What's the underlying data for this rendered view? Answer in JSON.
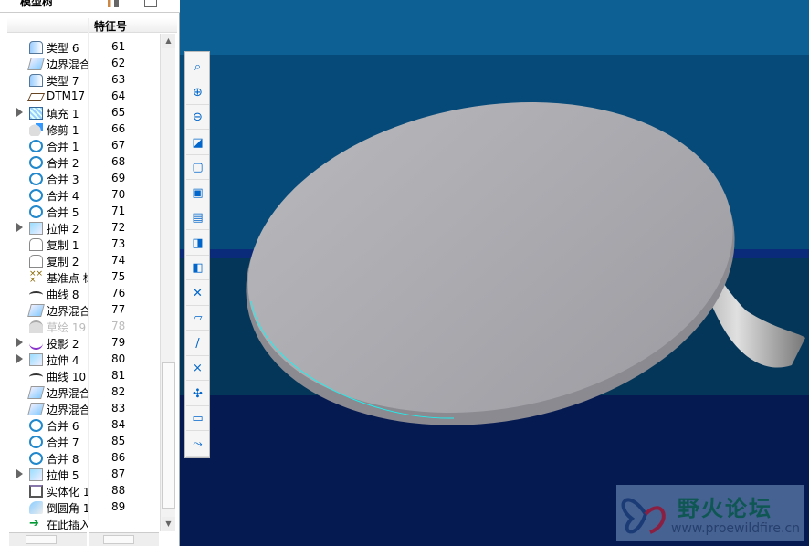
{
  "panel": {
    "title": "模型树",
    "column_header": "特征号"
  },
  "tree": [
    {
      "name": "类型 6",
      "id": "61",
      "icon": "surface-icon"
    },
    {
      "name": "边界混合",
      "id": "62",
      "icon": "boundary-blend-icon"
    },
    {
      "name": "类型 7",
      "id": "63",
      "icon": "surface-icon"
    },
    {
      "name": "DTM17",
      "id": "64",
      "icon": "datum-plane-icon"
    },
    {
      "name": "填充 1",
      "id": "65",
      "icon": "fill-icon",
      "expand": true
    },
    {
      "name": "修剪 1",
      "id": "66",
      "icon": "trim-icon"
    },
    {
      "name": "合并 1",
      "id": "67",
      "icon": "merge-icon"
    },
    {
      "name": "合并 2",
      "id": "68",
      "icon": "merge-icon"
    },
    {
      "name": "合并 3",
      "id": "69",
      "icon": "merge-icon"
    },
    {
      "name": "合并 4",
      "id": "70",
      "icon": "merge-icon"
    },
    {
      "name": "合并 5",
      "id": "71",
      "icon": "merge-icon"
    },
    {
      "name": "拉伸 2",
      "id": "72",
      "icon": "extrude-icon",
      "expand": true
    },
    {
      "name": "复制 1",
      "id": "73",
      "icon": "copy-icon"
    },
    {
      "name": "复制 2",
      "id": "74",
      "icon": "copy-icon"
    },
    {
      "name": "基准点 标",
      "id": "75",
      "icon": "datum-point-icon"
    },
    {
      "name": "曲线 8",
      "id": "76",
      "icon": "curve-icon"
    },
    {
      "name": "边界混合",
      "id": "77",
      "icon": "boundary-blend-icon"
    },
    {
      "name": "草绘 19",
      "id": "78",
      "icon": "sketch-icon",
      "dim": true
    },
    {
      "name": "投影 2",
      "id": "79",
      "icon": "project-icon",
      "expand": true
    },
    {
      "name": "拉伸 4",
      "id": "80",
      "icon": "extrude-icon",
      "expand": true
    },
    {
      "name": "曲线 10",
      "id": "81",
      "icon": "curve-icon"
    },
    {
      "name": "边界混合",
      "id": "82",
      "icon": "boundary-blend-icon"
    },
    {
      "name": "边界混合",
      "id": "83",
      "icon": "boundary-blend-icon"
    },
    {
      "name": "合并 6",
      "id": "84",
      "icon": "merge-icon"
    },
    {
      "name": "合并 7",
      "id": "85",
      "icon": "merge-icon"
    },
    {
      "name": "合并 8",
      "id": "86",
      "icon": "merge-icon"
    },
    {
      "name": "拉伸 5",
      "id": "87",
      "icon": "extrude-icon",
      "expand": true
    },
    {
      "name": "实体化 1",
      "id": "88",
      "icon": "solidify-icon"
    },
    {
      "name": "倒圆角 1",
      "id": "89",
      "icon": "round-icon"
    },
    {
      "name": "在此插入",
      "id": "",
      "icon": "insert-here-arrow-icon"
    }
  ],
  "toolbar": [
    {
      "name": "refit-icon",
      "glyph": "⌕"
    },
    {
      "name": "zoom-in-icon",
      "glyph": "⊕"
    },
    {
      "name": "zoom-out-icon",
      "glyph": "⊖"
    },
    {
      "name": "repaint-icon",
      "glyph": "◪"
    },
    {
      "name": "saved-views-icon",
      "glyph": "▢"
    },
    {
      "name": "view-manager-icon",
      "glyph": "▣"
    },
    {
      "name": "layers-icon",
      "glyph": "▤"
    },
    {
      "name": "orient-icon",
      "glyph": "◨"
    },
    {
      "name": "reorient-icon",
      "glyph": "◧"
    },
    {
      "name": "datum-display-icon",
      "glyph": "✕"
    },
    {
      "name": "plane-display-icon",
      "glyph": "▱"
    },
    {
      "name": "axis-display-icon",
      "glyph": "/"
    },
    {
      "name": "point-display-icon",
      "glyph": "×"
    },
    {
      "name": "csys-display-icon",
      "glyph": "✣"
    },
    {
      "name": "annotation-display-icon",
      "glyph": "▭"
    },
    {
      "name": "spin-center-icon",
      "glyph": "⤳"
    }
  ],
  "watermark": {
    "name": "野火论坛",
    "url": "www.proewildfire.cn"
  }
}
